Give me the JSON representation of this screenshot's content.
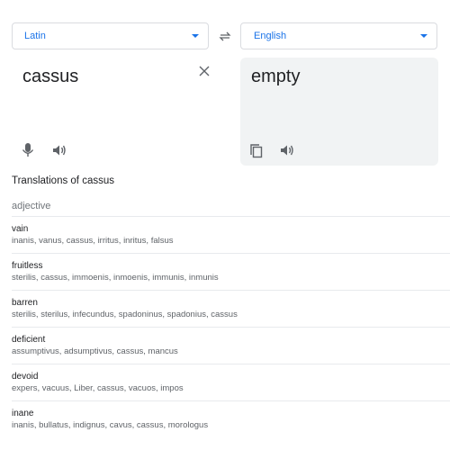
{
  "source_language": {
    "label": "Latin"
  },
  "target_language": {
    "label": "English"
  },
  "source": {
    "text": "cassus"
  },
  "target": {
    "text": "empty"
  },
  "translations": {
    "heading": "Translations of cassus",
    "part_of_speech": "adjective",
    "entries": [
      {
        "word": "vain",
        "synonyms": "inanis, vanus, cassus, irritus, inritus, falsus"
      },
      {
        "word": "fruitless",
        "synonyms": "sterilis, cassus, immoenis, inmoenis, immunis, inmunis"
      },
      {
        "word": "barren",
        "synonyms": "sterilis, sterilus, infecundus, spadoninus, spadonius, cassus"
      },
      {
        "word": "deficient",
        "synonyms": "assumptivus, adsumptivus, cassus, mancus"
      },
      {
        "word": "devoid",
        "synonyms": "expers, vacuus, Liber, cassus, vacuos, impos"
      },
      {
        "word": "inane",
        "synonyms": "inanis, bullatus, indignus, cavus, cassus, morologus"
      }
    ]
  },
  "icons": {
    "swap": "swap-icon",
    "clear": "close-icon",
    "mic": "microphone-icon",
    "speaker": "speaker-icon",
    "copy": "copy-icon",
    "dropdown": "chevron-down-icon"
  },
  "colors": {
    "accent": "#1a73e8",
    "panel": "#f1f3f4",
    "icon": "#5f6368"
  }
}
